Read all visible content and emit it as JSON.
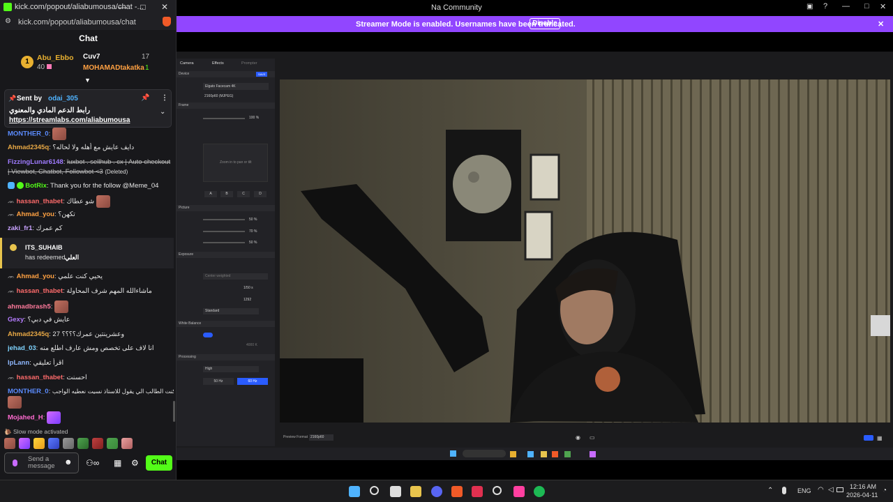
{
  "popup": {
    "title": "kick.com/popout/aliabumousa/chat -...",
    "url": "kick.com/popout/aliabumousa/chat",
    "header": "Chat"
  },
  "leaderboard": {
    "rank": "1",
    "first_name": "Abu_Ebbo",
    "first_count": "40",
    "second_name": "Cuv7",
    "second_count": "17",
    "third_name": "MOHAMADtakatka",
    "third_count": "1"
  },
  "pinned": {
    "sent_by_label": "Sent by",
    "sender": "odai_305",
    "text": "رابط الدعم المادي والمعنوي",
    "link": "https://streamlabs.com/aliabumousa"
  },
  "messages": [
    {
      "user": "MONTHER_0",
      "text": "",
      "color": "#5b8cff",
      "emote": true
    },
    {
      "user": "Ahmad2345q",
      "text": "دايف عايش مع أهله ولا لحاله؟",
      "color": "#e8a845"
    },
    {
      "user": "FizzingLunar6148",
      "text": "luxbot . sellhub . cx | Auto checkout",
      "text2": "| Viewbot, Chatbot, Followbot <3",
      "deleted": "(Deleted)",
      "color": "#9f7bff"
    },
    {
      "user": "BotRix",
      "text": "Thank you for the follow @Meme_04",
      "color": "#53fc18"
    },
    {
      "user": "hassan_thabet",
      "text": "شو عطاك",
      "color": "#ff6b6b",
      "emote": true
    },
    {
      "user": "Ahmad_you",
      "text": "تكهن؟",
      "color": "#ffa142"
    },
    {
      "user": "zaki_fr1",
      "text": "كم عمرك",
      "color": "#c9a3ff"
    },
    {
      "user": "Ahmad_you",
      "text": "يحيي كنت علمي",
      "color": "#ffa142"
    },
    {
      "user": "hassan_thabet",
      "text": "ماشاءالله المهم شرف المحاولة",
      "color": "#ff6b6b"
    },
    {
      "user": "ahmadbrash5",
      "text": "",
      "color": "#ff7a9c",
      "emote": true
    },
    {
      "user": "Gexy",
      "text": "عايش في دبي؟",
      "color": "#b57cff"
    },
    {
      "user": "Ahmad2345q",
      "text": "27 وعشرينتين عمرك؟؟؟؟",
      "color": "#e8a845"
    },
    {
      "user": "jehad_03",
      "text": "انا لاف على تخصص ومش عارف اطلع منه",
      "color": "#7fd4ff"
    },
    {
      "user": "IpLann",
      "text": "اقرأ تعليقي",
      "color": "#8fb8ff"
    },
    {
      "user": "hassan_thabet",
      "text": "احسنت",
      "color": "#ff6b6b"
    },
    {
      "user": "MONTHER_0",
      "text": "شكلك كنت الطالب الي يقول للاستاذ نسيت نعطيه الواجب",
      "color": "#5b8cff",
      "emote": true
    },
    {
      "user": "Mojahed_H",
      "text": "",
      "color": "#ff6bd0"
    }
  ],
  "redeem": {
    "user": "ITS_SUHAIB",
    "text": "has redeemed",
    "reward": "العلي"
  },
  "slow_mode": "Slow mode activated",
  "input": {
    "placeholder": "Send a message",
    "send": "Chat"
  },
  "browser": {
    "tab_title": "Na Community",
    "streamer_banner": "Streamer Mode is enabled. Usernames have been truncated.",
    "disable": "Disable"
  },
  "camera_hub": {
    "tabs": [
      "Camera",
      "Effects",
      "Prompter"
    ],
    "device_label": "Device",
    "save": "SAVE",
    "device": "Elgato Facecam 4K",
    "format": "2160p60 (MJPEG)",
    "frame": "Frame",
    "fov": "100 %",
    "picture": "Picture",
    "contrast": "50 %",
    "saturation": "70 %",
    "sharpness": "50 %",
    "exposure": "Exposure",
    "metering": "Center weighted",
    "shutter": "1/50 s",
    "iso": "1292",
    "dynamic_range": "Standard",
    "white_balance": "White Balance",
    "wb_value": "4000 K",
    "processing": "Processing",
    "noise": "High",
    "hz50": "50 Hz",
    "hz60": "60 Hz",
    "zoom_hint": "Zoom in to pan or tilt",
    "presets": [
      "A",
      "B",
      "C",
      "D"
    ],
    "preview_format_label": "Preview Format",
    "preview_format": "2160p60"
  },
  "taskbar": {
    "lang": "ENG",
    "time": "12:16 AM",
    "date": "2026-04-11"
  }
}
